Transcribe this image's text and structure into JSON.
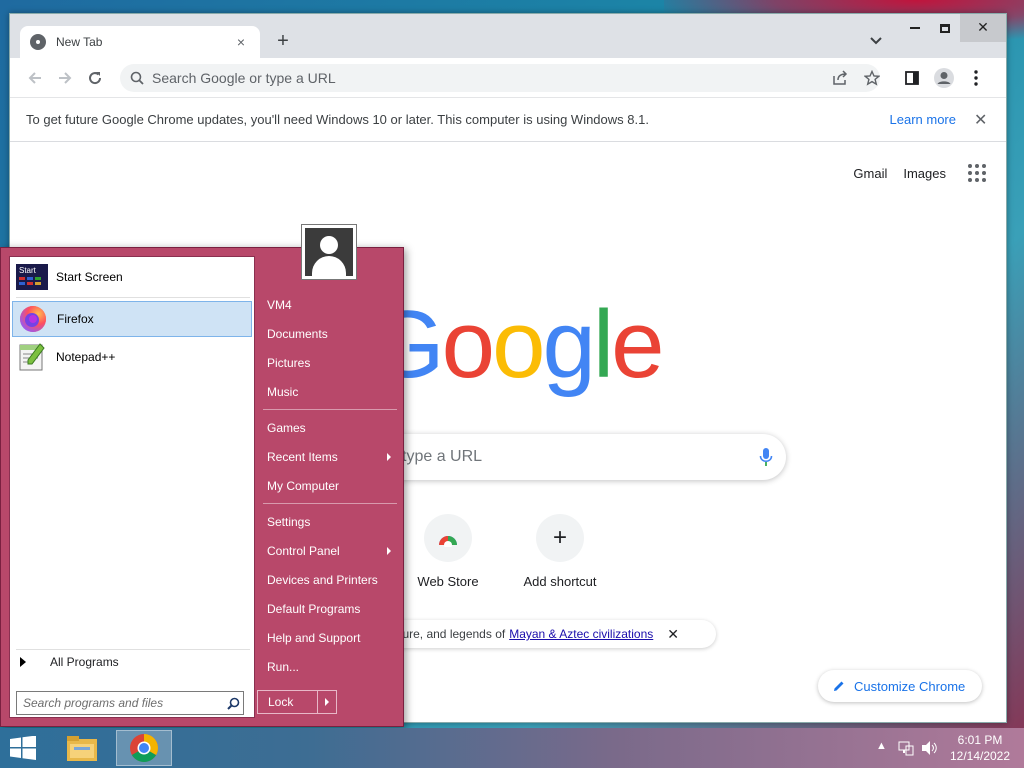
{
  "browser": {
    "tab_title": "New Tab",
    "tab_close": "×",
    "new_tab": "+",
    "omnibox_placeholder": "Search Google or type a URL",
    "infobar_text": "To get future Google Chrome updates, you'll need Windows 10 or later. This computer is using Windows 8.1.",
    "infobar_link": "Learn more",
    "infobar_close": "✕"
  },
  "newtab": {
    "gmail": "Gmail",
    "images": "Images",
    "logo": [
      "G",
      "o",
      "o",
      "g",
      "l",
      "e"
    ],
    "search_visible_text": "type a URL",
    "shortcuts": [
      {
        "label": "Web Store",
        "icon": "web-store-icon"
      },
      {
        "label": "Add shortcut",
        "icon": "plus-icon",
        "glyph": "+"
      }
    ],
    "doodle_text": "y, culture, and legends of",
    "doodle_link": "Mayan & Aztec civilizations",
    "doodle_close": "✕",
    "customize": "Customize Chrome"
  },
  "startmenu": {
    "pinned": [
      {
        "label": "Start Screen",
        "icon": "start-screen-icon",
        "badge": "Start"
      },
      {
        "label": "Firefox",
        "icon": "firefox-icon"
      },
      {
        "label": "Notepad++",
        "icon": "notepadpp-icon"
      }
    ],
    "all_programs": "All Programs",
    "search_placeholder": "Search programs and files",
    "right_items": [
      {
        "label": "VM4"
      },
      {
        "label": "Documents"
      },
      {
        "label": "Pictures"
      },
      {
        "label": "Music"
      },
      {
        "label": "Games"
      },
      {
        "label": "Recent Items",
        "submenu": true
      },
      {
        "label": "My Computer"
      },
      {
        "label": "Settings"
      },
      {
        "label": "Control Panel",
        "submenu": true
      },
      {
        "label": "Devices and Printers"
      },
      {
        "label": "Default Programs"
      },
      {
        "label": "Help and Support"
      },
      {
        "label": "Run..."
      }
    ],
    "lock": "Lock"
  },
  "taskbar": {
    "time": "6:01 PM",
    "date": "12/14/2022"
  },
  "colors": {
    "startmenu_bg": "#b8486a",
    "chrome_link": "#1a73e8"
  }
}
